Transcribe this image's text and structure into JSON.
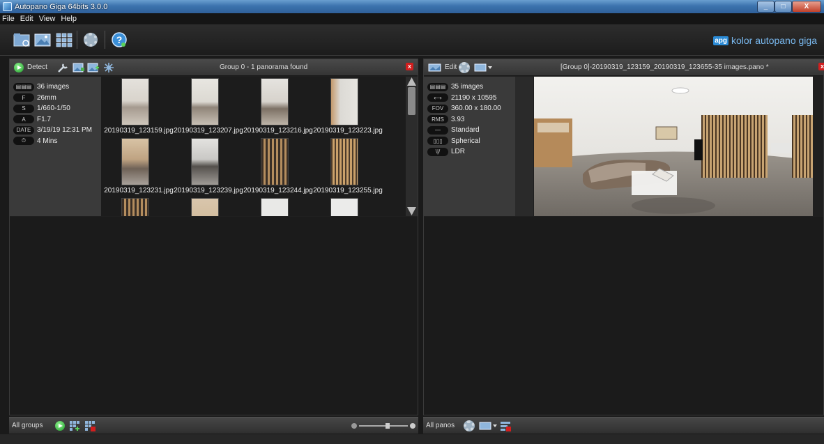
{
  "window": {
    "title": "Autopano Giga 64bits 3.0.0",
    "min": "_",
    "max": "□",
    "close": "X"
  },
  "menu": [
    "File",
    "Edit",
    "View",
    "Help"
  ],
  "brand": {
    "badge": "apg",
    "text": "kolor autopano giga"
  },
  "left_panel": {
    "detect_label": "Detect",
    "title": "Group 0 - 1 panorama found",
    "close": "x",
    "info": [
      {
        "tag": "▤▤▤",
        "value": "36 images"
      },
      {
        "tag": "F",
        "value": "26mm"
      },
      {
        "tag": "S",
        "value": "1/660-1/50"
      },
      {
        "tag": "A",
        "value": "F1.7"
      },
      {
        "tag": "DATE",
        "value": "3/19/19 12:31 PM"
      },
      {
        "tag": "⏱",
        "value": "4 Mins"
      }
    ],
    "images": [
      "20190319_123159.jpg",
      "20190319_123207.jpg",
      "20190319_123216.jpg",
      "20190319_123223.jpg",
      "20190319_123231.jpg",
      "20190319_123239.jpg",
      "20190319_123244.jpg",
      "20190319_123255.jpg"
    ]
  },
  "right_panel": {
    "edit_label": "Edit",
    "title": "[Group 0]-20190319_123159_20190319_123655-35 images.pano *",
    "close": "x",
    "info": [
      {
        "tag": "▤▤▤",
        "value": "35 images"
      },
      {
        "tag": "⟷",
        "value": "21190 x 10595"
      },
      {
        "tag": "FOV",
        "value": "360.00 x 180.00"
      },
      {
        "tag": "RMS",
        "value": "3.93"
      },
      {
        "tag": "—",
        "value": "Standard"
      },
      {
        "tag": "▯▯▯",
        "value": "Spherical"
      },
      {
        "tag": "\\|/",
        "value": "LDR"
      }
    ]
  },
  "bottom_left": {
    "label": "All groups"
  },
  "bottom_right": {
    "label": "All panos"
  },
  "colors": {
    "accent": "#2b8bd6",
    "close_red": "#d21e1e",
    "play_green": "#1f9e2a"
  }
}
